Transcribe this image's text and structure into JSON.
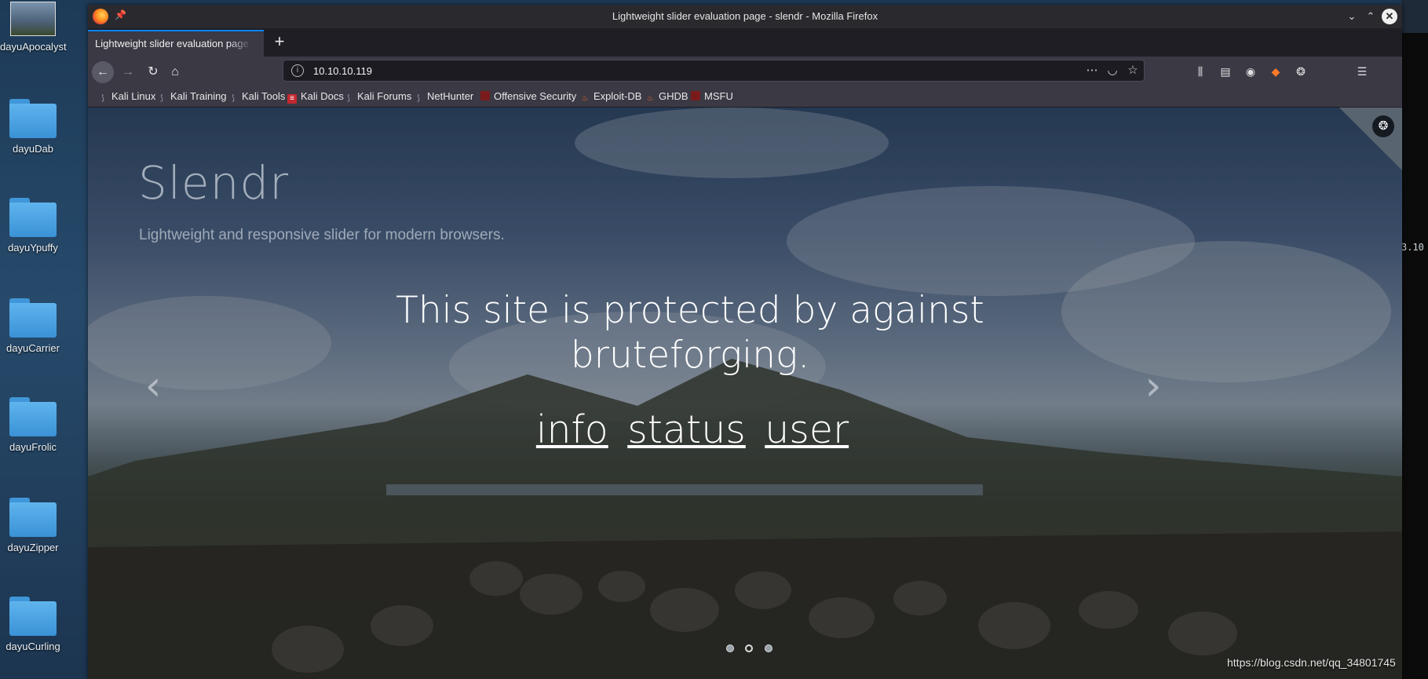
{
  "desktop": {
    "icons": [
      {
        "label": "dayuApocalyst"
      },
      {
        "label": "dayuDab"
      },
      {
        "label": "dayuYpuffy"
      },
      {
        "label": "dayuCarrier"
      },
      {
        "label": "dayuFrolic"
      },
      {
        "label": "dayuZipper"
      },
      {
        "label": "dayuCurling"
      }
    ],
    "side_text": "3.10"
  },
  "window": {
    "title": "Lightweight slider evaluation page - slendr - Mozilla Firefox",
    "tab_title": "Lightweight slider evaluation page - slendr",
    "url": "10.10.10.119",
    "bookmarks": [
      {
        "label": "Kali Linux",
        "icon": "kali-dragon-icon"
      },
      {
        "label": "Kali Training",
        "icon": "kali-dragon-icon"
      },
      {
        "label": "Kali Tools",
        "icon": "kali-dragon-icon"
      },
      {
        "label": "Kali Docs",
        "icon": "kali-docs-icon"
      },
      {
        "label": "Kali Forums",
        "icon": "kali-dragon-icon"
      },
      {
        "label": "NetHunter",
        "icon": "kali-dragon-icon"
      },
      {
        "label": "Offensive Security",
        "icon": "offsec-icon"
      },
      {
        "label": "Exploit-DB",
        "icon": "exploitdb-icon"
      },
      {
        "label": "GHDB",
        "icon": "exploitdb-icon"
      },
      {
        "label": "MSFU",
        "icon": "offsec-icon"
      }
    ]
  },
  "page": {
    "brand_title": "Slendr",
    "brand_subtitle": "Lightweight and responsive slider for modern browsers.",
    "headline": "This site is protected by against bruteforging.",
    "links": [
      "info",
      "status",
      "user"
    ],
    "slides_total": 3
  },
  "watermark": "https://blog.csdn.net/qq_34801745"
}
